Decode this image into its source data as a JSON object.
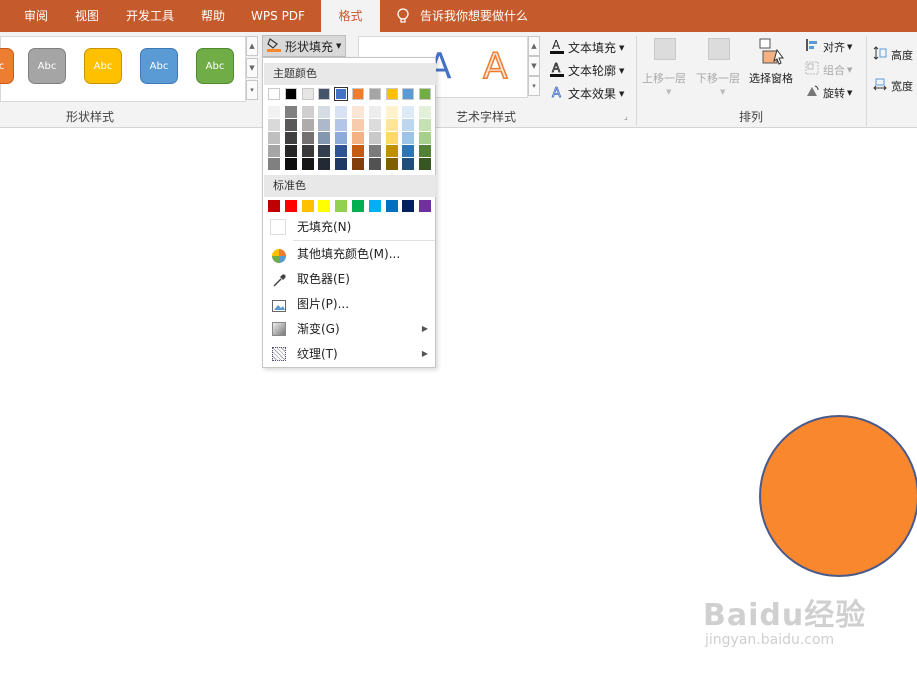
{
  "tabs": [
    "审阅",
    "视图",
    "开发工具",
    "帮助",
    "WPS PDF",
    "格式"
  ],
  "active_tab": "格式",
  "tellme": "告诉我你想要做什么",
  "ribbon": {
    "shape_styles": {
      "label": "形状样式",
      "buttons": [
        {
          "text": "Abc",
          "color": "#ed7d31"
        },
        {
          "text": "Abc",
          "color": "#a5a5a5"
        },
        {
          "text": "Abc",
          "color": "#ffc000"
        },
        {
          "text": "Abc",
          "color": "#5b9bd5"
        },
        {
          "text": "Abc",
          "color": "#70ad47"
        }
      ]
    },
    "shape_fill_label": "形状填充",
    "art_text": {
      "label": "艺术字样式",
      "sample": "A",
      "fill": "文本填充",
      "outline": "文本轮廓",
      "effect": "文本效果"
    },
    "arrange": {
      "label": "排列",
      "bring_forward": "上移一层",
      "send_backward": "下移一层",
      "selection_pane": "选择窗格",
      "align": "对齐",
      "group": "组合",
      "rotate": "旋转"
    },
    "size": {
      "height": "高度",
      "width": "宽度"
    }
  },
  "fill_menu": {
    "theme_colors_label": "主题颜色",
    "theme_colors": [
      "#ffffff",
      "#000000",
      "#e7e6e6",
      "#44546a",
      "#4472c4",
      "#ed7d31",
      "#a5a5a5",
      "#ffc000",
      "#5b9bd5",
      "#70ad47"
    ],
    "theme_shades": [
      [
        "#f2f2f2",
        "#d9d9d9",
        "#bfbfbf",
        "#a6a6a6",
        "#808080"
      ],
      [
        "#808080",
        "#595959",
        "#404040",
        "#262626",
        "#0d0d0d"
      ],
      [
        "#d0cece",
        "#afabab",
        "#767171",
        "#3a3838",
        "#171616"
      ],
      [
        "#d6dce4",
        "#adb9ca",
        "#8497b0",
        "#333f4f",
        "#222a35"
      ],
      [
        "#d9e2f3",
        "#b4c6e7",
        "#8eaadb",
        "#2f5496",
        "#1f3864"
      ],
      [
        "#fbe5d5",
        "#f7cbac",
        "#f4b183",
        "#c55a11",
        "#833c0b"
      ],
      [
        "#ededed",
        "#dbdbdb",
        "#c9c9c9",
        "#7b7b7b",
        "#525252"
      ],
      [
        "#fff2cc",
        "#fee599",
        "#ffd965",
        "#bf9000",
        "#7f6000"
      ],
      [
        "#deebf6",
        "#bdd7ee",
        "#9dc3e6",
        "#2e75b5",
        "#1e4e79"
      ],
      [
        "#e2efd9",
        "#c5e0b3",
        "#a8d08d",
        "#538135",
        "#375623"
      ]
    ],
    "selected_theme_index": 4,
    "standard_colors_label": "标准色",
    "standard_colors": [
      "#c00000",
      "#ff0000",
      "#ffc000",
      "#ffff00",
      "#92d050",
      "#00b050",
      "#00b0f0",
      "#0070c0",
      "#002060",
      "#7030a0"
    ],
    "no_fill": "无填充(N)",
    "more_colors": "其他填充颜色(M)...",
    "eyedropper": "取色器(E)",
    "picture": "图片(P)...",
    "gradient": "渐变(G)",
    "texture": "纹理(T)"
  },
  "shape_fill_color": "#f8872e",
  "watermark": {
    "brand": "Baidu经验",
    "url": "jingyan.baidu.com"
  }
}
